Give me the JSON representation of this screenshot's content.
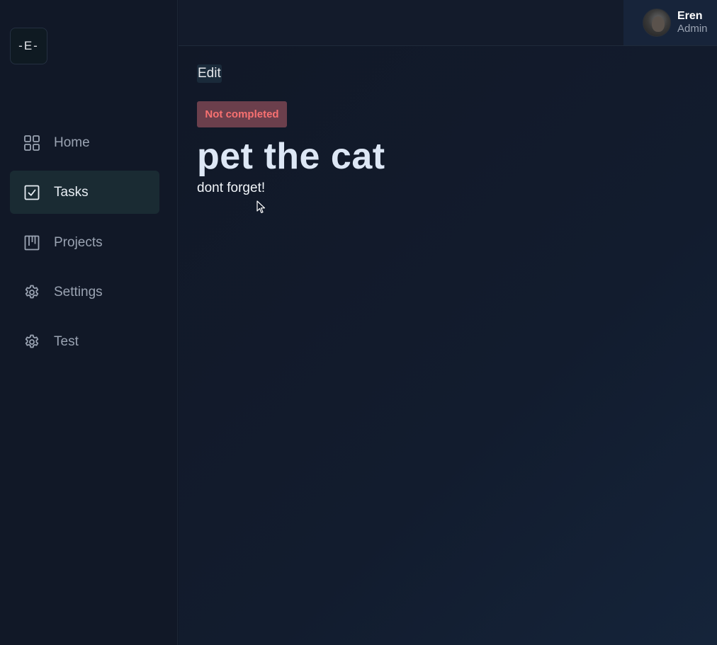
{
  "sidebar": {
    "logo": "-E-",
    "items": [
      {
        "label": "Home",
        "icon": "grid-icon",
        "active": false
      },
      {
        "label": "Tasks",
        "icon": "check-square-icon",
        "active": true
      },
      {
        "label": "Projects",
        "icon": "kanban-icon",
        "active": false
      },
      {
        "label": "Settings",
        "icon": "gear-icon",
        "active": false
      },
      {
        "label": "Test",
        "icon": "gear-icon",
        "active": false
      }
    ]
  },
  "header": {
    "user": {
      "name": "Eren",
      "role": "Admin"
    }
  },
  "main": {
    "edit_label": "Edit",
    "status": "Not completed",
    "title": "pet the cat",
    "description": "dont forget!"
  },
  "colors": {
    "status_text": "#f87171",
    "status_bg": "#6b3f4c",
    "active_nav_bg": "#1a2b33"
  }
}
